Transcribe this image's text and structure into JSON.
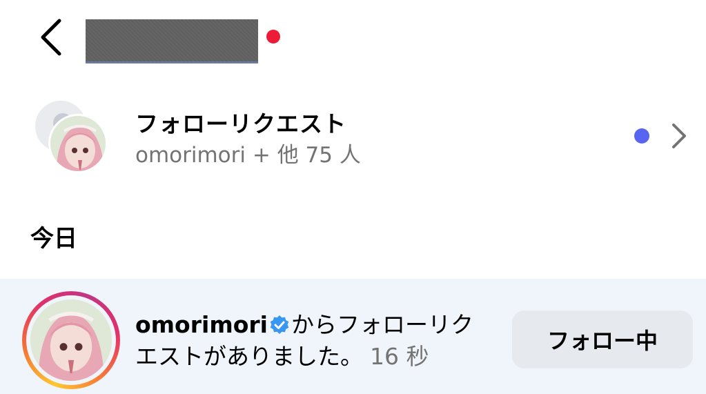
{
  "header": {
    "title_dot_color": "#ee1b36"
  },
  "follow_requests": {
    "title": "フォローリクエスト",
    "subtitle": "omorimori + 他 75 人",
    "unread_dot_color": "#5865f0"
  },
  "section": {
    "today_label": "今日"
  },
  "notification": {
    "username": "omorimori",
    "verified": true,
    "message_line_1": "からフォローリク",
    "message_line_2": "エストがありました。",
    "time": "16 秒",
    "action_label": "フォロー中"
  },
  "icons": {
    "back": "chevron-left-icon",
    "chevron": "chevron-right-icon",
    "verified": "verified-badge-icon"
  }
}
